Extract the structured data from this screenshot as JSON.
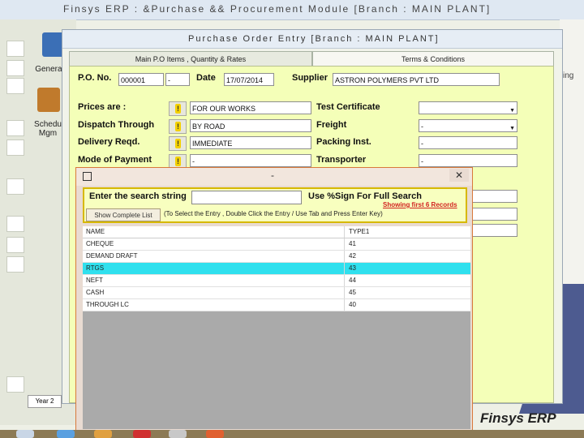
{
  "bg_window": {
    "title": "Finsys ERP : &Purchase && Procurement Module  [Branch : MAIN PLANT]",
    "sidebar_icons": [
      {
        "label": "General",
        "icon": "book-icon"
      },
      {
        "label": "Schedu Mgm",
        "icon": "briefcase-icon"
      }
    ],
    "side_right_text": "ing",
    "year_button": "Year 2",
    "bottom_logo": "Finsys ERP"
  },
  "po_window": {
    "title": "Purchase Order Entry   [Branch : MAIN PLANT]",
    "tabs": [
      {
        "label": "Main P.O Items , Quantity & Rates"
      },
      {
        "label": "Terms & Conditions"
      }
    ],
    "header": {
      "po_no_label": "P.O. No.",
      "po_no_value": "000001",
      "po_suffix": "-",
      "date_label": "Date",
      "date_value": "17/07/2014",
      "supplier_label": "Supplier",
      "supplier_value": "ASTRON POLYMERS PVT LTD"
    },
    "fields": {
      "prices_label": "Prices are :",
      "prices_value": "FOR OUR WORKS",
      "dispatch_label": "Dispatch Through",
      "dispatch_value": "BY ROAD",
      "delivery_label": "Delivery Reqd.",
      "delivery_value": "IMMEDIATE",
      "payment_label": "Mode of Payment",
      "payment_value": "-",
      "test_cert_label": "Test Certificate",
      "test_cert_value": "",
      "freight_label": "Freight",
      "freight_value": "-",
      "packing_label": "Packing Inst.",
      "packing_value": "-",
      "transporter_label": "Transporter",
      "transporter_value": "-"
    }
  },
  "search_dialog": {
    "title": "-",
    "close": "✕",
    "enter_label": "Enter the search string",
    "search_value": "",
    "use_label": "Use %Sign For Full Search",
    "showing": "Showing first 6 Records",
    "show_button": "Show Complete List",
    "hint": "(To Select the Entry , Double Click the Entry / Use Tab and Press Enter Key)",
    "columns": [
      "NAME",
      "TYPE1"
    ],
    "rows": [
      {
        "name": "CHEQUE",
        "type": "41"
      },
      {
        "name": "DEMAND DRAFT",
        "type": "42"
      },
      {
        "name": "RTGS",
        "type": "43"
      },
      {
        "name": "NEFT",
        "type": "44"
      },
      {
        "name": "CASH",
        "type": "45"
      },
      {
        "name": "THROUGH LC",
        "type": "40"
      }
    ],
    "selected_index": 2
  },
  "colors": {
    "form_bg": "#f4ffb8",
    "selected_row": "#30e0ee",
    "dialog_border": "#d8793b",
    "warn_icon": "#f3d000"
  }
}
